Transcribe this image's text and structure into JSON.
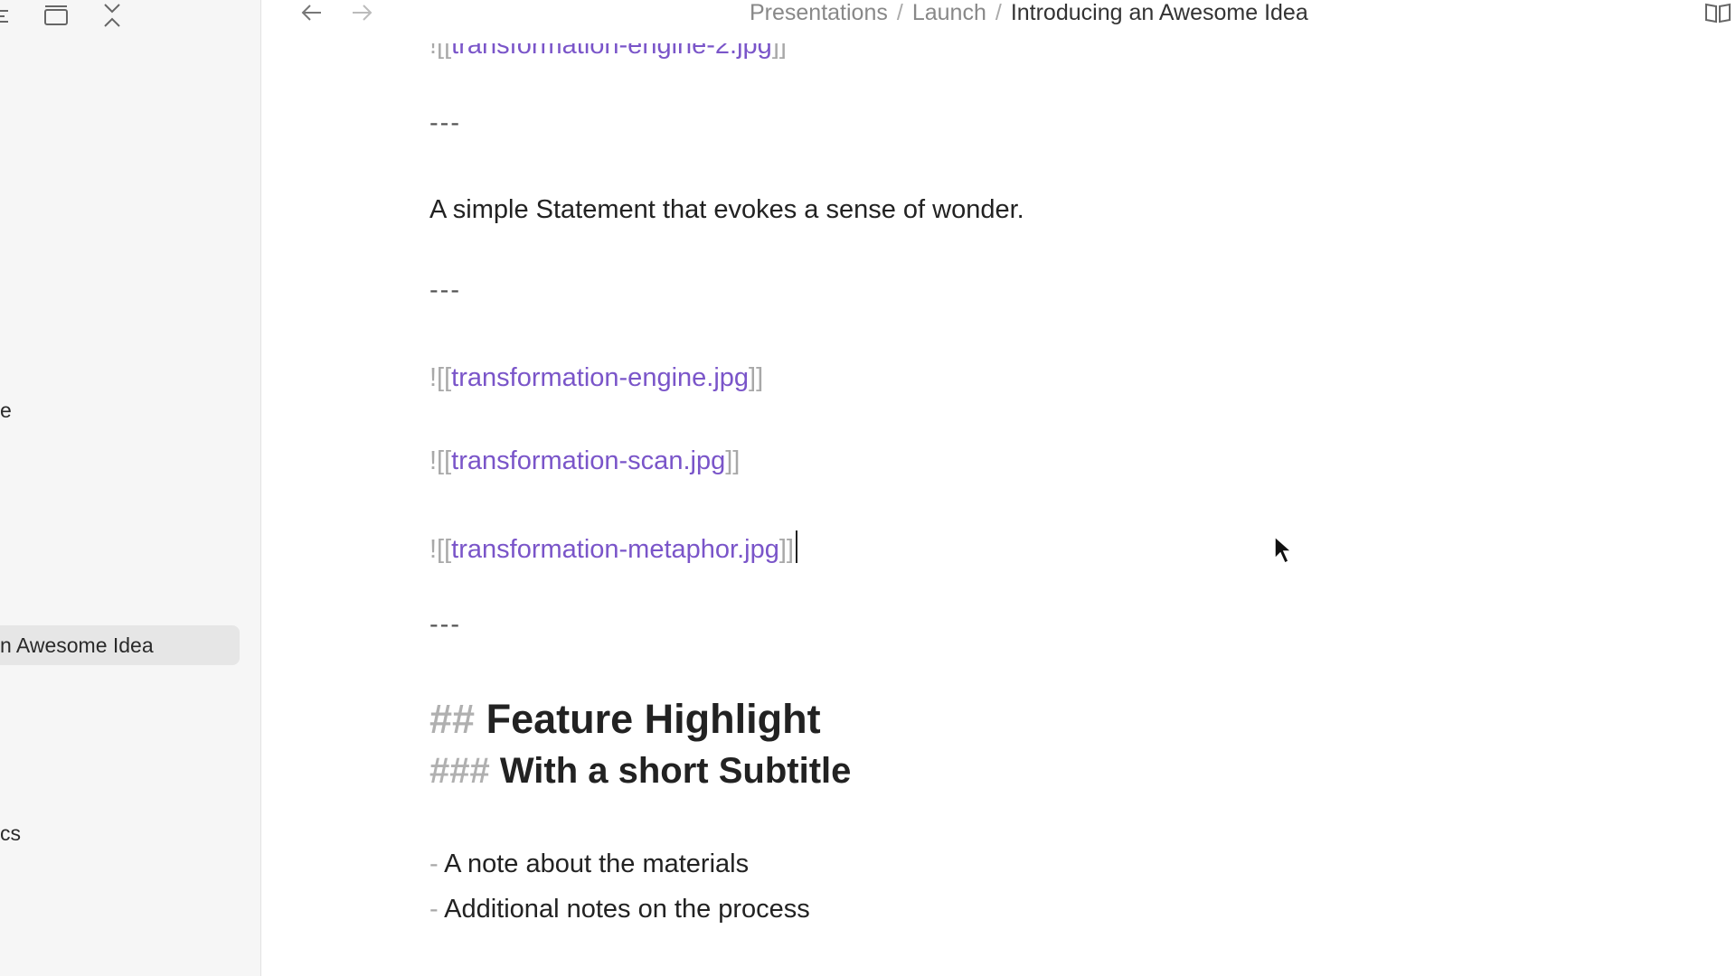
{
  "sidebar": {
    "toolbar_icons": [
      "outline-icon",
      "layout-icon",
      "collapse-icon"
    ],
    "items": [
      {
        "label": "e"
      },
      {
        "label": "n Awesome Idea",
        "active": true
      },
      {
        "label": "cs"
      }
    ]
  },
  "topbar": {
    "breadcrumb": {
      "items": [
        "Presentations",
        "Launch"
      ],
      "current": "Introducing an Awesome Idea",
      "separator": "/"
    }
  },
  "editor": {
    "top_partial": {
      "prefix": "![[",
      "link": "transformation-engine-2.jpg",
      "suffix": "]]"
    },
    "hr_mark": "---",
    "statement": "A simple Statement that evokes a sense of wonder.",
    "embeds": [
      {
        "prefix": "![[",
        "link": "transformation-engine.jpg",
        "suffix": "]]"
      },
      {
        "prefix": "![[",
        "link": "transformation-scan.jpg",
        "suffix": "]]"
      },
      {
        "prefix": "![[",
        "link": "transformation-metaphor.jpg",
        "suffix": "]]"
      }
    ],
    "heading2": {
      "marker": "##",
      "text": "Feature Highlight"
    },
    "heading3": {
      "marker": "###",
      "text": "With a short Subtitle"
    },
    "bullets": [
      {
        "marker": "-",
        "text": "A note about the materials"
      },
      {
        "marker": "-",
        "text": "Additional notes on the process"
      }
    ]
  },
  "colors": {
    "link": "#7a55c9",
    "muted": "#a8a8a8",
    "sidebar_bg": "#f6f6f6",
    "active_item_bg": "#e6e6e6"
  }
}
